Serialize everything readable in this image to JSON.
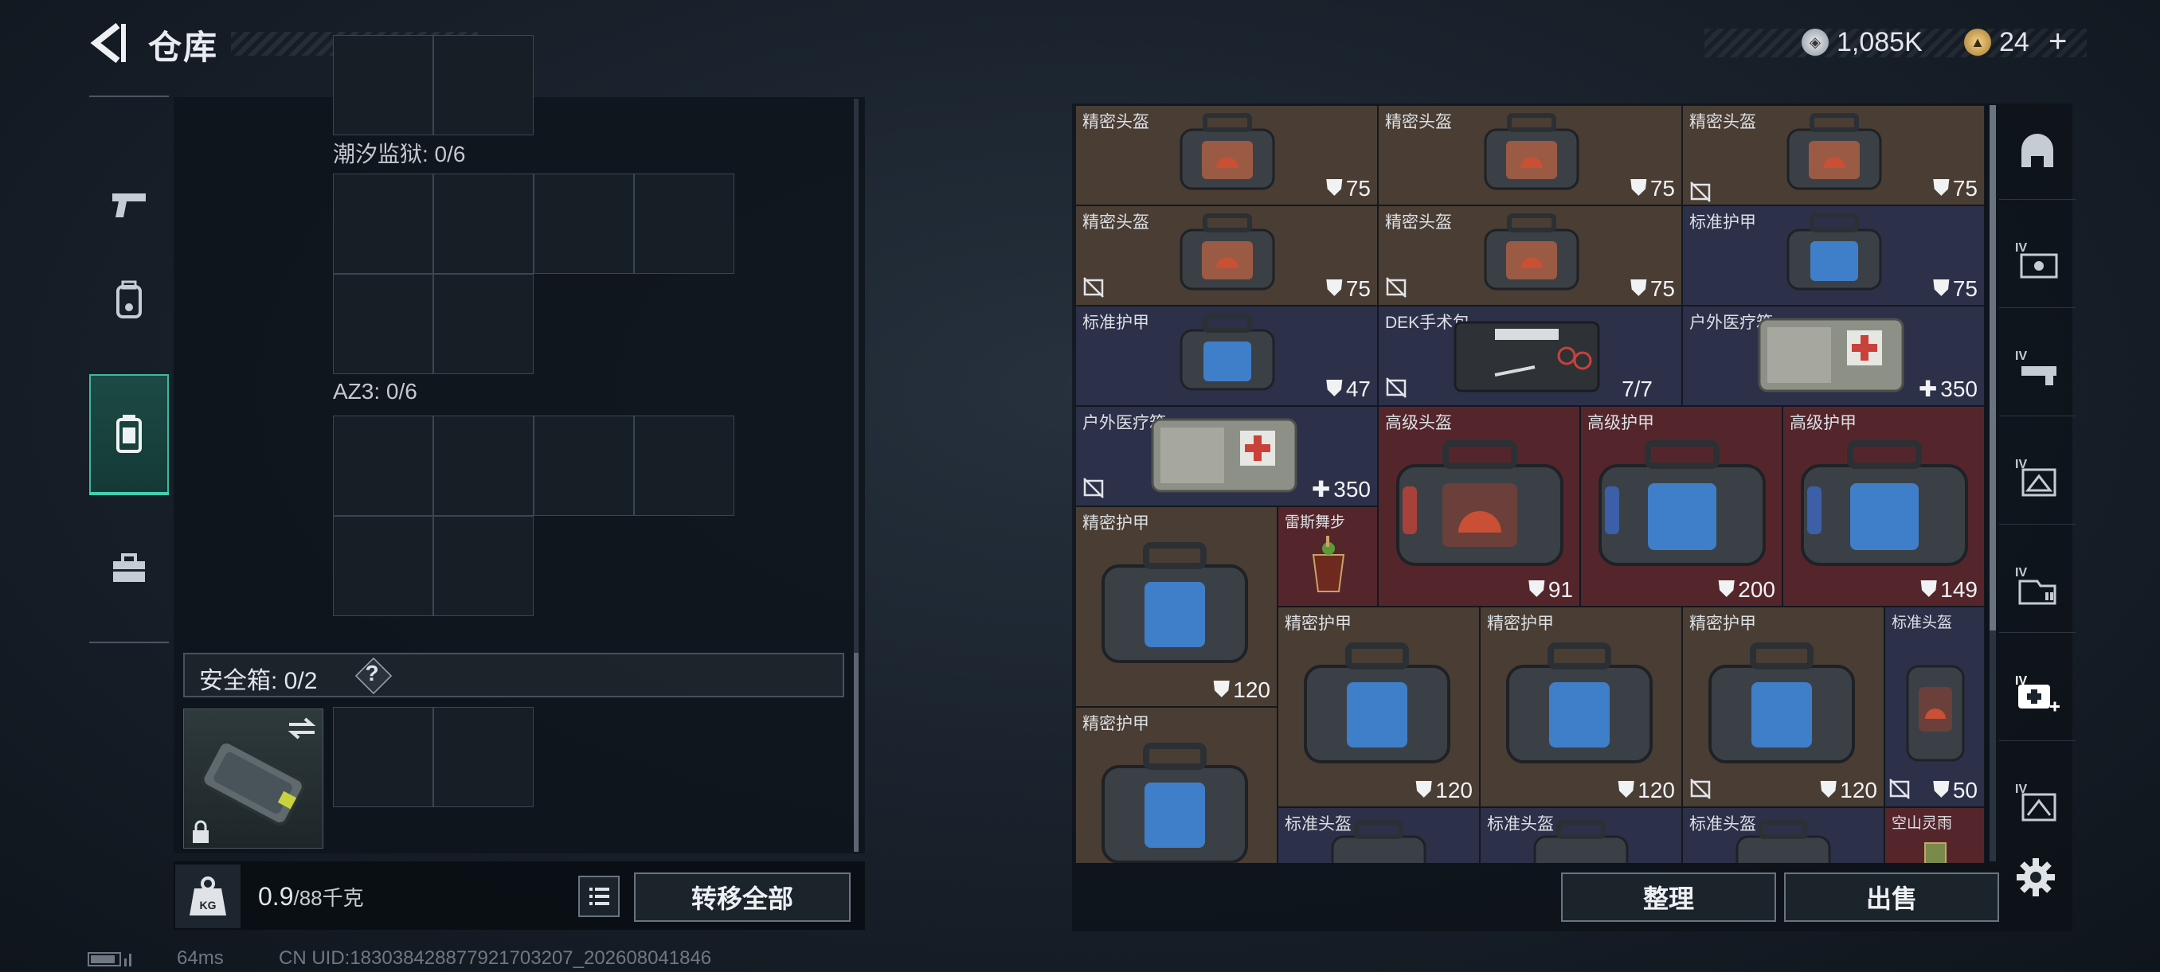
{
  "header": {
    "title": "仓库",
    "back_icon": "back-arrow-icon"
  },
  "currency": {
    "silver_value": "1,085K",
    "gold_value": "24",
    "gold_plus": "+"
  },
  "left_nav": [
    "pistol-icon",
    "backpack-icon",
    "container-icon",
    "toolbox-icon"
  ],
  "left_panel": {
    "sections": [
      {
        "label": "潮汐监狱: 0/6"
      },
      {
        "label": "AZ3: 0/6"
      }
    ],
    "safe_box": {
      "label": "安全箱: 0/2",
      "help": "?"
    }
  },
  "bottom_left": {
    "weight_value": "0.9",
    "weight_unit": "/88千克",
    "kg_label": "KG",
    "move_all": "转移全部"
  },
  "status": {
    "ping": "64ms",
    "uid": "CN UID:183038428877921703207_202608041846"
  },
  "items": [
    {
      "name": "精密头盔",
      "value": "75",
      "icon": "shield",
      "color": "brown",
      "locked": false
    },
    {
      "name": "精密头盔",
      "value": "75",
      "icon": "shield",
      "color": "brown",
      "locked": false
    },
    {
      "name": "精密头盔",
      "value": "75",
      "icon": "shield",
      "color": "brown",
      "locked": true
    },
    {
      "name": "精密头盔",
      "value": "75",
      "icon": "shield",
      "color": "brown",
      "locked": true
    },
    {
      "name": "精密头盔",
      "value": "75",
      "icon": "shield",
      "color": "brown",
      "locked": true
    },
    {
      "name": "标准护甲",
      "value": "75",
      "icon": "shield",
      "color": "navy",
      "locked": false
    },
    {
      "name": "标准护甲",
      "value": "47",
      "icon": "shield",
      "color": "navy",
      "locked": false
    },
    {
      "name": "DEK手术包",
      "value": "7/7",
      "icon": "none",
      "color": "navy",
      "locked": true
    },
    {
      "name": "户外医疗箱",
      "value": "350",
      "icon": "plus",
      "color": "navy",
      "locked": false
    },
    {
      "name": "户外医疗箱",
      "value": "350",
      "icon": "plus",
      "color": "navy",
      "locked": true
    },
    {
      "name": "高级头盔",
      "value": "91",
      "icon": "shield",
      "color": "red",
      "locked": false
    },
    {
      "name": "高级护甲",
      "value": "200",
      "icon": "shield",
      "color": "red",
      "locked": false
    },
    {
      "name": "高级护甲",
      "value": "149",
      "icon": "shield",
      "color": "red",
      "locked": false
    },
    {
      "name": "精密护甲",
      "value": "120",
      "icon": "shield",
      "color": "brown",
      "locked": false
    },
    {
      "name": "雷斯舞步",
      "value": "",
      "icon": "none",
      "color": "red",
      "locked": false
    },
    {
      "name": "精密护甲",
      "value": "120",
      "icon": "shield",
      "color": "brown",
      "locked": false
    },
    {
      "name": "精密护甲",
      "value": "120",
      "icon": "shield",
      "color": "brown",
      "locked": false
    },
    {
      "name": "精密护甲",
      "value": "120",
      "icon": "shield",
      "color": "brown",
      "locked": true
    },
    {
      "name": "标准头盔",
      "value": "50",
      "icon": "shield",
      "color": "navy",
      "locked": true
    },
    {
      "name": "精密护甲",
      "value": "",
      "icon": "none",
      "color": "brown",
      "locked": false
    },
    {
      "name": "标准头盔",
      "value": "",
      "icon": "none",
      "color": "navy",
      "locked": false
    },
    {
      "name": "标准头盔",
      "value": "",
      "icon": "none",
      "color": "navy",
      "locked": false
    },
    {
      "name": "标准头盔",
      "value": "",
      "icon": "none",
      "color": "navy",
      "locked": false
    },
    {
      "name": "空山灵雨",
      "value": "",
      "icon": "none",
      "color": "red",
      "locked": false
    }
  ],
  "right_actions": {
    "sort": "整理",
    "sell": "出售"
  },
  "right_nav": [
    "helmet-slot-icon",
    "level4-weapon-icon",
    "level4-gun-icon",
    "level4-armor-icon",
    "level4-container-icon",
    "level4-medkit-icon",
    "level4-misc-icon"
  ],
  "colors": {
    "brown": "#4a3d34",
    "navy": "#2d3049",
    "red": "#54262b",
    "accent": "#3fd0b0"
  }
}
